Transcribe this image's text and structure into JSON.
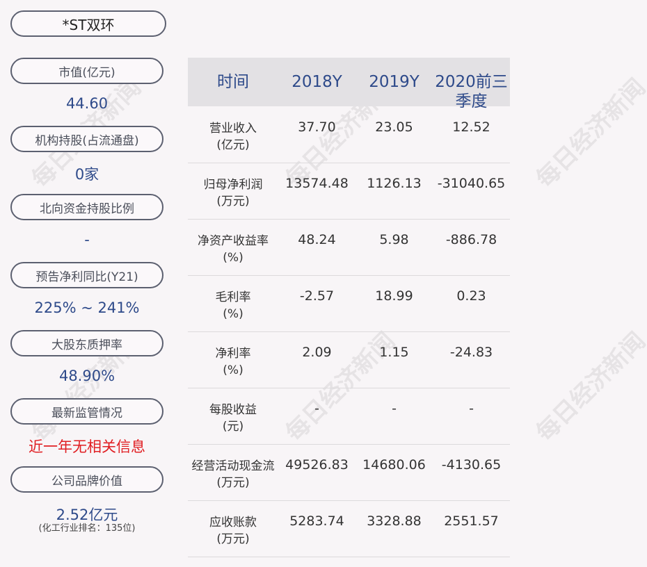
{
  "stock_name": "*ST双环",
  "left_panel": [
    {
      "label": "市值(亿元)",
      "value": "44.60"
    },
    {
      "label": "机构持股(占流通盘)",
      "value": "0家"
    },
    {
      "label": "北向资金持股比例",
      "value": "-"
    },
    {
      "label": "预告净利同比(Y21)",
      "value": "225% ~ 241%"
    },
    {
      "label": "大股东质押率",
      "value": "48.90%"
    },
    {
      "label": "最新监管情况",
      "value": "近一年无相关信息"
    },
    {
      "label": "公司品牌价值",
      "value": "2.52亿元",
      "sub": "(化工行业排名：135位)"
    }
  ],
  "table": {
    "headers": [
      "时间",
      "2018Y",
      "2019Y",
      "2020前三季度"
    ],
    "rows": [
      {
        "label": "营业收入(亿元)",
        "label_line1": "营业收入",
        "label_line2": "(亿元)",
        "values": [
          "37.70",
          "23.05",
          "12.52"
        ]
      },
      {
        "label": "归母净利润(万元)",
        "label_line1": "归母净利润",
        "label_line2": "(万元)",
        "values": [
          "13574.48",
          "1126.13",
          "-31040.65"
        ]
      },
      {
        "label": "净资产收益率(%)",
        "label_line1": "净资产收益率",
        "label_line2": "(%)",
        "values": [
          "48.24",
          "5.98",
          "-886.78"
        ]
      },
      {
        "label": "毛利率(%)",
        "label_line1": "毛利率",
        "label_line2": "(%)",
        "values": [
          "-2.57",
          "18.99",
          "0.23"
        ]
      },
      {
        "label": "净利率(%)",
        "label_line1": "净利率",
        "label_line2": "(%)",
        "values": [
          "2.09",
          "1.15",
          "-24.83"
        ]
      },
      {
        "label": "每股收益(元)",
        "label_line1": "每股收益",
        "label_line2": "(元)",
        "values": [
          "-",
          "-",
          "-"
        ]
      },
      {
        "label": "经营活动现金流(万元)",
        "label_line1": "经营活动现金流",
        "label_line2": "(万元)",
        "values": [
          "49526.83",
          "14680.06",
          "-4130.65"
        ]
      },
      {
        "label": "应收账款(万元)",
        "label_line1": "应收账款",
        "label_line2": "(万元)",
        "values": [
          "5283.74",
          "3328.88",
          "2551.57"
        ]
      }
    ]
  },
  "watermark": "每日经济新闻",
  "colors": {
    "value_blue": "#2e4a8a",
    "alert_red": "#e01e22",
    "header_bg": "#e3e1e4",
    "background": "#f8f5f7"
  }
}
